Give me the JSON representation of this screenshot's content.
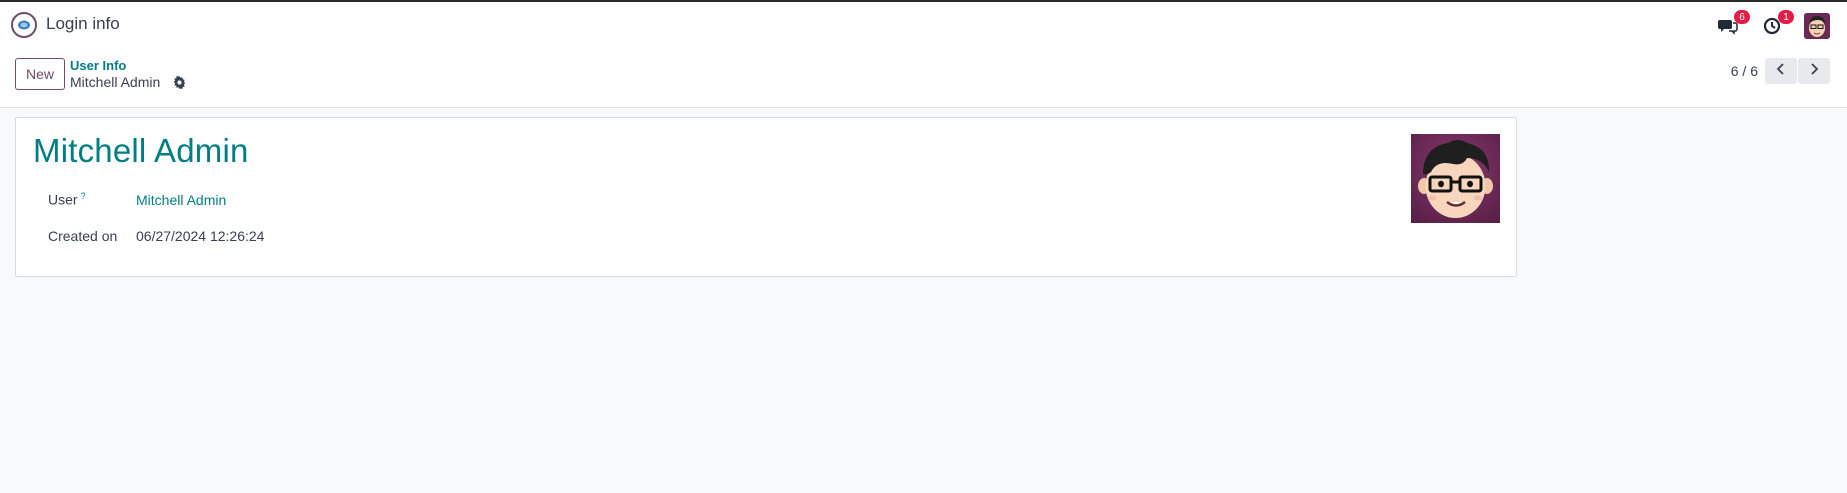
{
  "app": {
    "title": "Login info",
    "app_icon": "discuss-icon"
  },
  "systray": {
    "messages_count": "6",
    "activities_count": "1",
    "icons": [
      "chat-icon",
      "clock-icon",
      "user-avatar"
    ]
  },
  "control_panel": {
    "new_label": "New",
    "breadcrumb_parent": "User Info",
    "breadcrumb_current": "Mitchell Admin",
    "pager": "6 / 6"
  },
  "form": {
    "title": "Mitchell Admin",
    "fields": {
      "user_label": "User",
      "user_help": "?",
      "user_value": "Mitchell Admin",
      "created_label": "Created on",
      "created_value": "06/27/2024 12:26:24"
    }
  },
  "colors": {
    "brand": "#714b67",
    "link": "#017e84",
    "badge": "#e11d48",
    "background": "#f8f9fa"
  }
}
